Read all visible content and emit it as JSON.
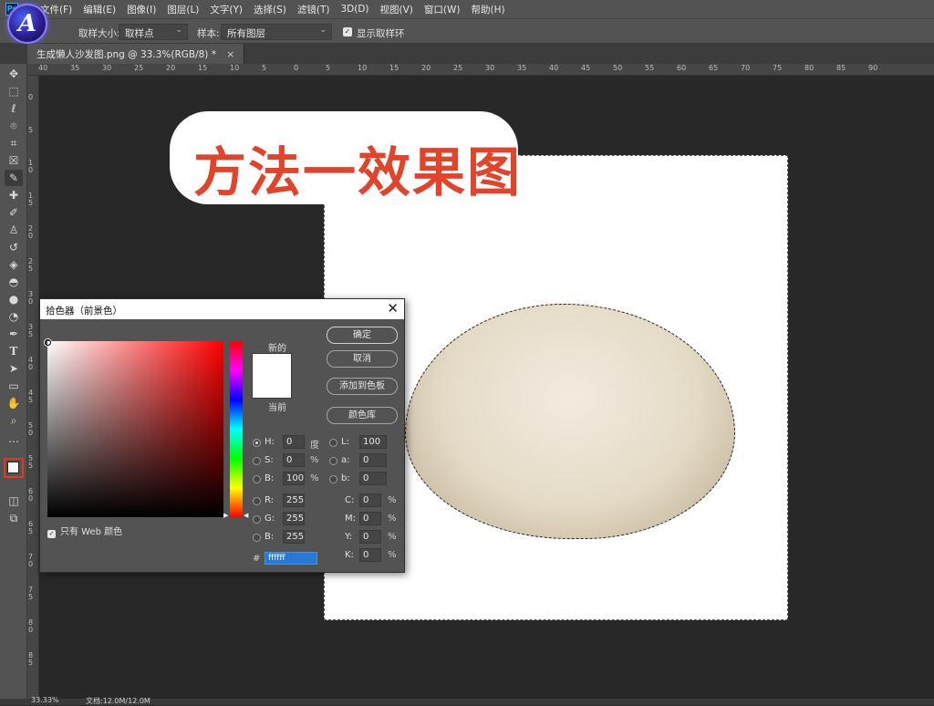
{
  "menu": {
    "app_icon": "Ps",
    "items": [
      "文件(F)",
      "编辑(E)",
      "图像(I)",
      "图层(L)",
      "文字(Y)",
      "选择(S)",
      "滤镜(T)",
      "3D(D)",
      "视图(V)",
      "窗口(W)",
      "帮助(H)"
    ]
  },
  "badge": {
    "letter": "A"
  },
  "options": {
    "sample_size_label": "取样大小:",
    "sample_size_value": "取样点",
    "sample_label": "样本:",
    "sample_value": "所有图层",
    "show_ring_label": "显示取样环",
    "show_ring_checked": true
  },
  "tab": {
    "title": "生成懒人沙发图.png @ 33.3%(RGB/8) *",
    "close": "×"
  },
  "ruler_top": [
    "40",
    "35",
    "30",
    "25",
    "20",
    "15",
    "10",
    "5",
    "0",
    "5",
    "10",
    "15",
    "20",
    "25",
    "30",
    "35",
    "40",
    "45",
    "50",
    "55",
    "60",
    "65",
    "70",
    "75",
    "80",
    "85",
    "90"
  ],
  "ruler_left": [
    "0",
    "5",
    "1 0",
    "1 5",
    "2 0",
    "2 5",
    "3 0",
    "3 5",
    "4 0",
    "4 5",
    "5 0",
    "5 5",
    "6 0",
    "6 5",
    "7 0",
    "7 5",
    "8 0",
    "8 5"
  ],
  "canvas": {
    "title": "方法一效果图",
    "title_color": "#e1442a",
    "doc_background": "#ffffff"
  },
  "picker": {
    "title": "拾色器（前景色）",
    "new_label": "新的",
    "current_label": "当前",
    "buttons": {
      "ok": "确定",
      "cancel": "取消",
      "add_swatch": "添加到色板",
      "library": "颜色库"
    },
    "web_only_label": "只有 Web 颜色",
    "web_only_checked": true,
    "hsb": [
      {
        "label": "H:",
        "value": "0",
        "unit": "度",
        "selected": true
      },
      {
        "label": "S:",
        "value": "0",
        "unit": "%",
        "selected": false
      },
      {
        "label": "B:",
        "value": "100",
        "unit": "%",
        "selected": false
      }
    ],
    "rgb": [
      {
        "label": "R:",
        "value": "255"
      },
      {
        "label": "G:",
        "value": "255"
      },
      {
        "label": "B:",
        "value": "255"
      }
    ],
    "lab": [
      {
        "label": "L:",
        "value": "100"
      },
      {
        "label": "a:",
        "value": "0"
      },
      {
        "label": "b:",
        "value": "0"
      }
    ],
    "cmyk": [
      {
        "label": "C:",
        "value": "0",
        "unit": "%"
      },
      {
        "label": "M:",
        "value": "0",
        "unit": "%"
      },
      {
        "label": "Y:",
        "value": "0",
        "unit": "%"
      },
      {
        "label": "K:",
        "value": "0",
        "unit": "%"
      }
    ],
    "hex_label": "#",
    "hex_value": "ffffff",
    "foreground_color": "#ffffff"
  },
  "status": {
    "zoom": "33.33%",
    "doc": "文档:12.0M/12.0M"
  }
}
